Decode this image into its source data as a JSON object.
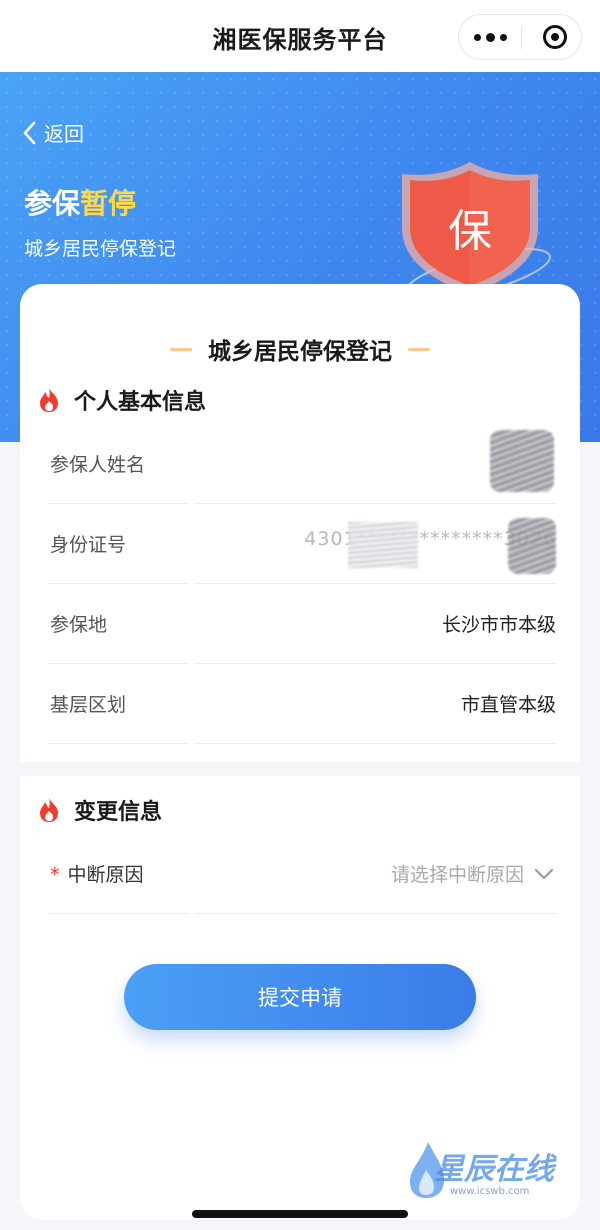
{
  "topbar": {
    "title": "湘医保服务平台"
  },
  "hero": {
    "back_label": "返回",
    "title_prefix": "参保",
    "title_accent": "暂停",
    "subtitle": "城乡居民停保登记",
    "shield_char": "保",
    "accent_color": "#ffd84a"
  },
  "card": {
    "heading": "城乡居民停保登记"
  },
  "basic_info": {
    "title": "个人基本信息",
    "rows": [
      {
        "label": "参保人姓名",
        "value": ""
      },
      {
        "label": "身份证号",
        "value": "4301**************3026"
      },
      {
        "label": "参保地",
        "value": "长沙市市本级"
      },
      {
        "label": "基层区划",
        "value": "市直管本级"
      }
    ]
  },
  "change_info": {
    "title": "变更信息",
    "required_mark": "*",
    "reason_label": "中断原因",
    "reason_placeholder": "请选择中断原因"
  },
  "submit_label": "提交申请",
  "watermark": {
    "text": "星辰在线",
    "url": "www.icswb.com"
  }
}
